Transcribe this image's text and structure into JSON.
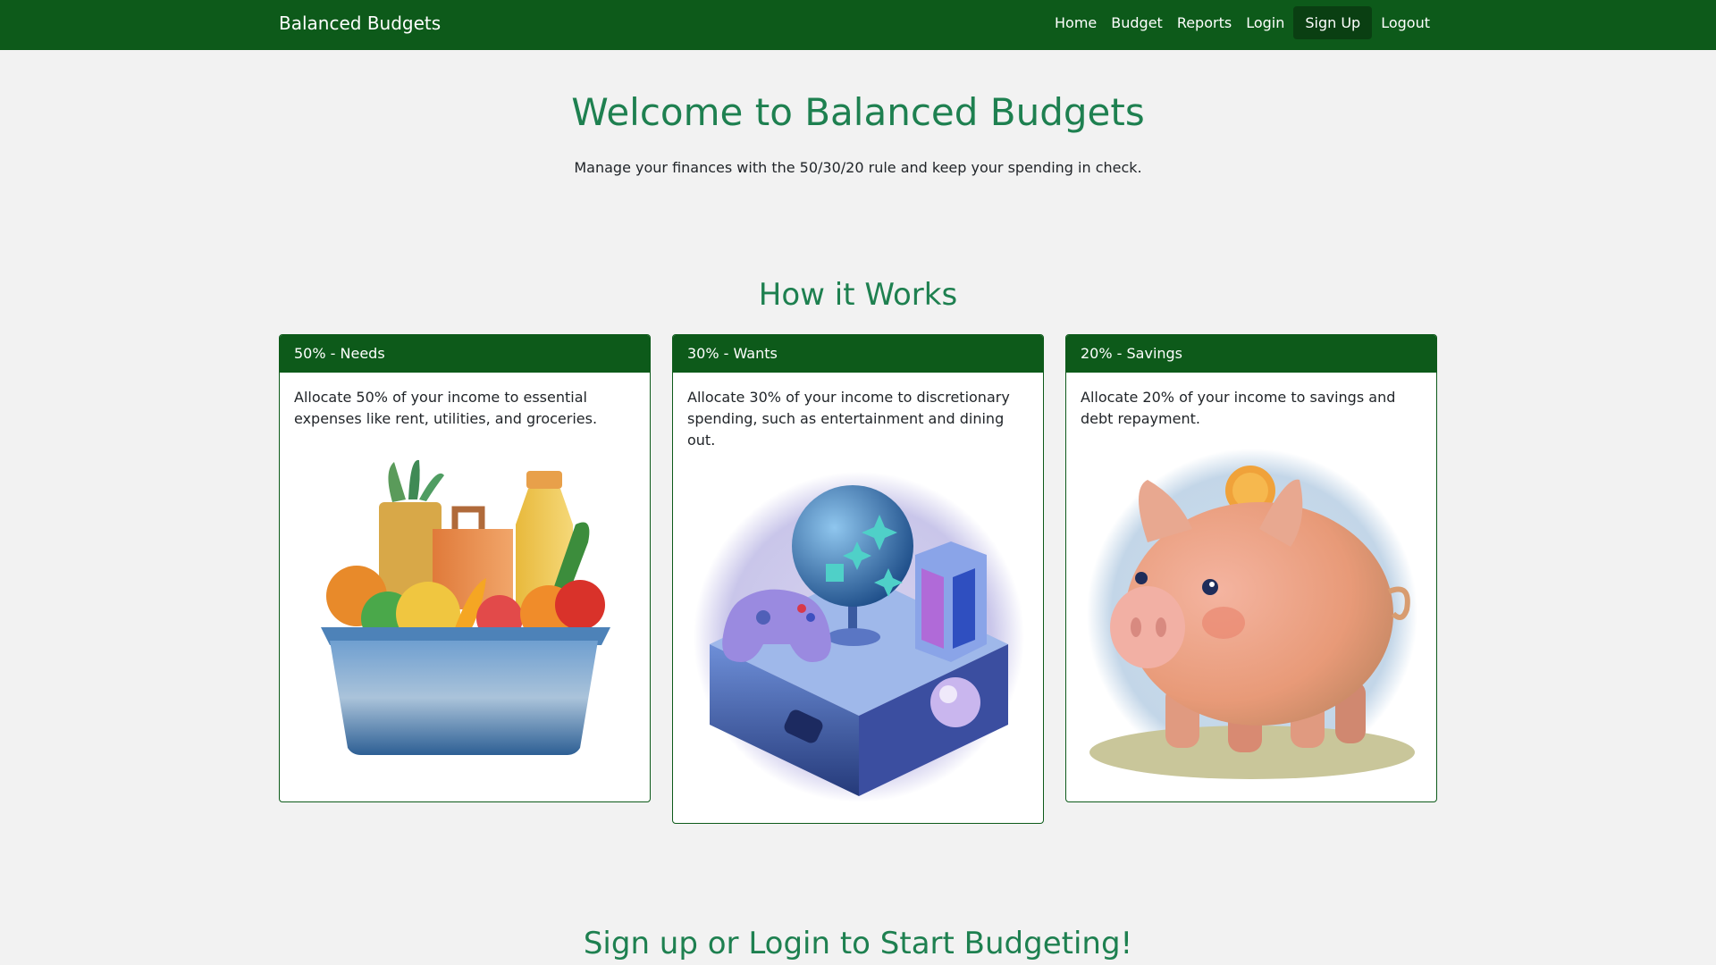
{
  "navbar": {
    "brand": "Balanced Budgets",
    "links": [
      {
        "label": "Home"
      },
      {
        "label": "Budget"
      },
      {
        "label": "Reports"
      },
      {
        "label": "Login"
      },
      {
        "label": "Sign Up"
      },
      {
        "label": "Logout"
      }
    ]
  },
  "hero": {
    "title": "Welcome to Balanced Budgets",
    "subtitle": "Manage your finances with the 50/30/20 rule and keep your spending in check."
  },
  "how": {
    "title": "How it Works",
    "cards": [
      {
        "header": "50% - Needs",
        "text": "Allocate 50% of your income to essential expenses like rent, utilities, and groceries.",
        "image": "grocery-box-illustration"
      },
      {
        "header": "30% - Wants",
        "text": "Allocate 30% of your income to discretionary spending, such as entertainment and dining out.",
        "image": "game-console-illustration"
      },
      {
        "header": "20% - Savings",
        "text": "Allocate 20% of your income to savings and debt repayment.",
        "image": "piggy-bank-illustration"
      }
    ]
  },
  "cta": {
    "title": "Sign up or Login to Start Budgeting!"
  },
  "colors": {
    "brand_green": "#0d5a1a",
    "heading_green": "#1e8050",
    "background": "#f2f2f2"
  }
}
